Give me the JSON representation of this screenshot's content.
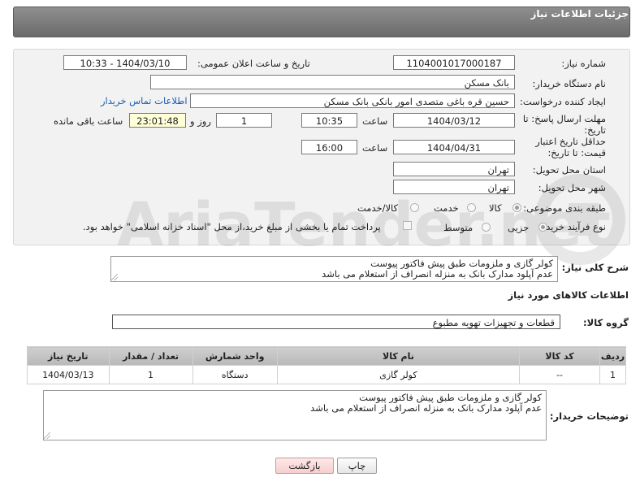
{
  "header": {
    "title": "جزئیات اطلاعات نیاز"
  },
  "form": {
    "need_number": {
      "label": "شماره نیاز:",
      "value": "1104001017000187"
    },
    "announce": {
      "label": "تاریخ و ساعت اعلان عمومی:",
      "value": "1404/03/10 - 10:33"
    },
    "buyer_org": {
      "label": "نام دستگاه خریدار:",
      "value": "بانک مسکن"
    },
    "creator": {
      "label": "ایجاد کننده درخواست:",
      "value": "حسین  قره باغی متصدی امور بانکی بانک مسکن",
      "contact_link": "اطلاعات تماس خریدار"
    },
    "reply_deadline": {
      "label": "مهلت ارسال پاسخ: تا تاریخ:",
      "date": "1404/03/12",
      "time_label": "ساعت",
      "time": "10:35",
      "days": "1",
      "days_label": "روز و",
      "remaining": "23:01:48",
      "remaining_label": "ساعت باقی مانده"
    },
    "price_validity": {
      "label": "حداقل تاریخ اعتبار قیمت: تا تاریخ:",
      "date": "1404/04/31",
      "time_label": "ساعت",
      "time": "16:00"
    },
    "province": {
      "label": "استان محل تحویل:",
      "value": "تهران"
    },
    "city": {
      "label": "شهر محل تحویل:",
      "value": "تهران"
    },
    "category": {
      "label": "طبقه بندی موضوعی:",
      "options": [
        "کالا",
        "خدمت",
        "کالا/خدمت"
      ],
      "selected": "کالا"
    },
    "process": {
      "label": "نوع فرآیند خرید :",
      "options": [
        "جزیی",
        "متوسط"
      ],
      "selected": "جزیی",
      "note": "پرداخت تمام یا بخشی از مبلغ خرید،از محل \"اسناد خزانه اسلامی\" خواهد بود."
    }
  },
  "summary": {
    "label": "شرح کلی نیاز:",
    "line1": "کولر گازی و ملزومات طبق پیش فاکتور پیوست",
    "line2": "عدم آپلود مدارک بانک به منزله انصراف از استعلام می باشد"
  },
  "goods": {
    "section_title": "اطلاعات کالاهای مورد نیاز",
    "group_label": "گروه کالا:",
    "group_value": "قطعات و تجهیزات تهویه مطبوع",
    "columns": [
      "ردیف",
      "کد کالا",
      "نام کالا",
      "واحد شمارش",
      "تعداد / مقدار",
      "تاریخ نیاز"
    ],
    "rows": [
      [
        "1",
        "--",
        "کولر گازی",
        "دستگاه",
        "1",
        "1404/03/13"
      ]
    ]
  },
  "buyer_notes": {
    "label": "توضیحات خریدار:",
    "line1": "کولر گازی و ملزومات طبق پیش فاکتور پیوست",
    "line2": "عدم آپلود مدارک بانک به منزله انصراف از استعلام می باشد"
  },
  "buttons": {
    "print": "چاپ",
    "back": "بازگشت"
  },
  "watermark": {
    "text": "AriaTender.net"
  }
}
